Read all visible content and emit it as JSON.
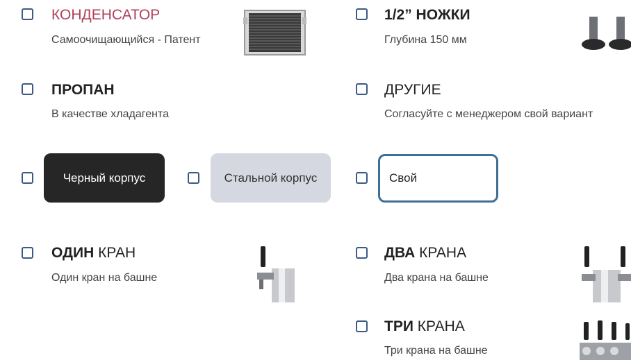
{
  "condenser": {
    "title": "КОНДЕНСАТОР",
    "subtitle": "Самоочищающийся - Патент"
  },
  "legs": {
    "title": "1/2” НОЖКИ",
    "subtitle": "Глубина 150 мм"
  },
  "propane": {
    "title": "ПРОПАН",
    "subtitle": "В качестве хладагента"
  },
  "other": {
    "title": "ДРУГИЕ",
    "subtitle": "Согласуйте с менеджером свой вариант"
  },
  "body_options": {
    "black": "Черный корпус",
    "steel": "Стальной корпус",
    "custom": "Свой"
  },
  "tap_one": {
    "title_bold": "ОДИН",
    "title_rest": " КРАН",
    "subtitle": "Один кран на башне"
  },
  "tap_two": {
    "title_bold": "ДВА",
    "title_rest": " КРАНА",
    "subtitle": "Два крана на башне"
  },
  "tap_three": {
    "title_bold": "ТРИ",
    "title_rest": " КРАНА",
    "subtitle": "Три крана на башне"
  },
  "colors": {
    "accent": "#b0405d",
    "checkbox": "#3c5a86",
    "black_chip": "#262626",
    "steel_chip": "#d5d8e0"
  }
}
